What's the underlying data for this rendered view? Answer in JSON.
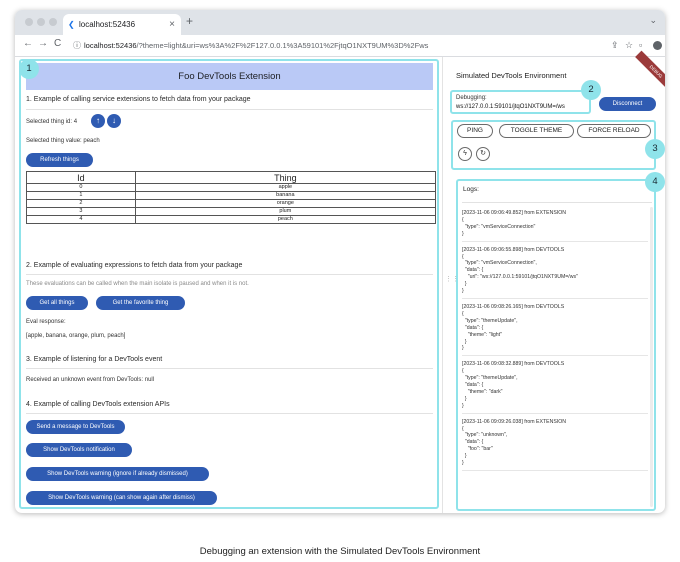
{
  "browser": {
    "tab_title": "localhost:52436",
    "tab_icon": "flutter-icon",
    "new_tab": "+",
    "close_tab": "×",
    "url_host": "localhost:52436",
    "url_rest": "/?theme=light&uri=ws%3A%2F%2F127.0.0.1%3A59101%2FjtqO1NXT9UM%3D%2Fws",
    "nav_back": "←",
    "nav_forward": "→",
    "nav_reload": "C",
    "lock": "ⓘ"
  },
  "extension": {
    "title": "Foo DevTools Extension",
    "section1": {
      "heading": "1. Example of calling service extensions to fetch data from your package",
      "selected_id_label": "Selected thing id: 4",
      "selected_value_label": "Selected thing value: peach",
      "refresh_button": "Refresh things",
      "table_headers": [
        "Id",
        "Thing"
      ],
      "rows": [
        {
          "id": "0",
          "thing": "apple"
        },
        {
          "id": "1",
          "thing": "banana"
        },
        {
          "id": "2",
          "thing": "orange"
        },
        {
          "id": "3",
          "thing": "plum"
        },
        {
          "id": "4",
          "thing": "peach"
        }
      ]
    },
    "section2": {
      "heading": "2. Example of evaluating expressions to fetch data from your package",
      "note": "These evaluations can be called when the main isolate is paused and when it is not.",
      "btn_all": "Get all things",
      "btn_fav": "Get the favorite thing",
      "eval_label": "Eval response:",
      "eval_value": "[apple, banana, orange, plum, peach]"
    },
    "section3": {
      "heading": "3. Example of listening for a DevTools event",
      "text": "Received an unknown event from DevTools: null"
    },
    "section4": {
      "heading": "4. Example of calling DevTools extension APIs",
      "btn_message": "Send a message to DevTools",
      "btn_notification": "Show DevTools notification",
      "btn_warning_ignore": "Show DevTools warning (ignore if already dismissed)",
      "btn_warning_again": "Show DevTools warning (can show again after dismiss)"
    }
  },
  "simulated": {
    "title": "Simulated DevTools Environment",
    "ribbon": "DEBUG",
    "debugging_label": "Debugging:",
    "debugging_uri": "ws://127.0.0.1:59101/jtqO1NXT9UM=/ws",
    "disconnect": "Disconnect",
    "ping": "PING",
    "toggle_theme": "TOGGLE THEME",
    "force_reload": "FORCE RELOAD",
    "logs_label": "Logs:",
    "logs": [
      "[2023-11-06 09:06:49.852] from EXTENSION\n{\n  \"type\": \"vmServiceConnection\"\n}",
      "[2023-11-06 09:06:55.898] from DEVTOOLS\n{\n  \"type\": \"vmServiceConnection\",\n  \"data\": {\n    \"uri\": \"ws://127.0.0.1:59101/jtqO1NXT9UM=/ws\"\n  }\n}",
      "[2023-11-06 09:08:26.165] from DEVTOOLS\n{\n  \"type\": \"themeUpdate\",\n  \"data\": {\n    \"theme\": \"light\"\n  }\n}",
      "[2023-11-06 09:08:32.889] from DEVTOOLS\n{\n  \"type\": \"themeUpdate\",\n  \"data\": {\n    \"theme\": \"dark\"\n  }\n}",
      "[2023-11-06 09:09:26.038] from EXTENSION\n{\n  \"type\": \"unknown\",\n  \"data\": {\n    \"foo\": \"bar\"\n  }\n}"
    ]
  },
  "callouts": {
    "c1": "1",
    "c2": "2",
    "c3": "3",
    "c4": "4"
  },
  "caption": "Debugging an extension with the Simulated DevTools Environment",
  "colors": {
    "accent": "#2f5bb2",
    "header": "#bac9f6",
    "callout": "#8fe3ea"
  }
}
